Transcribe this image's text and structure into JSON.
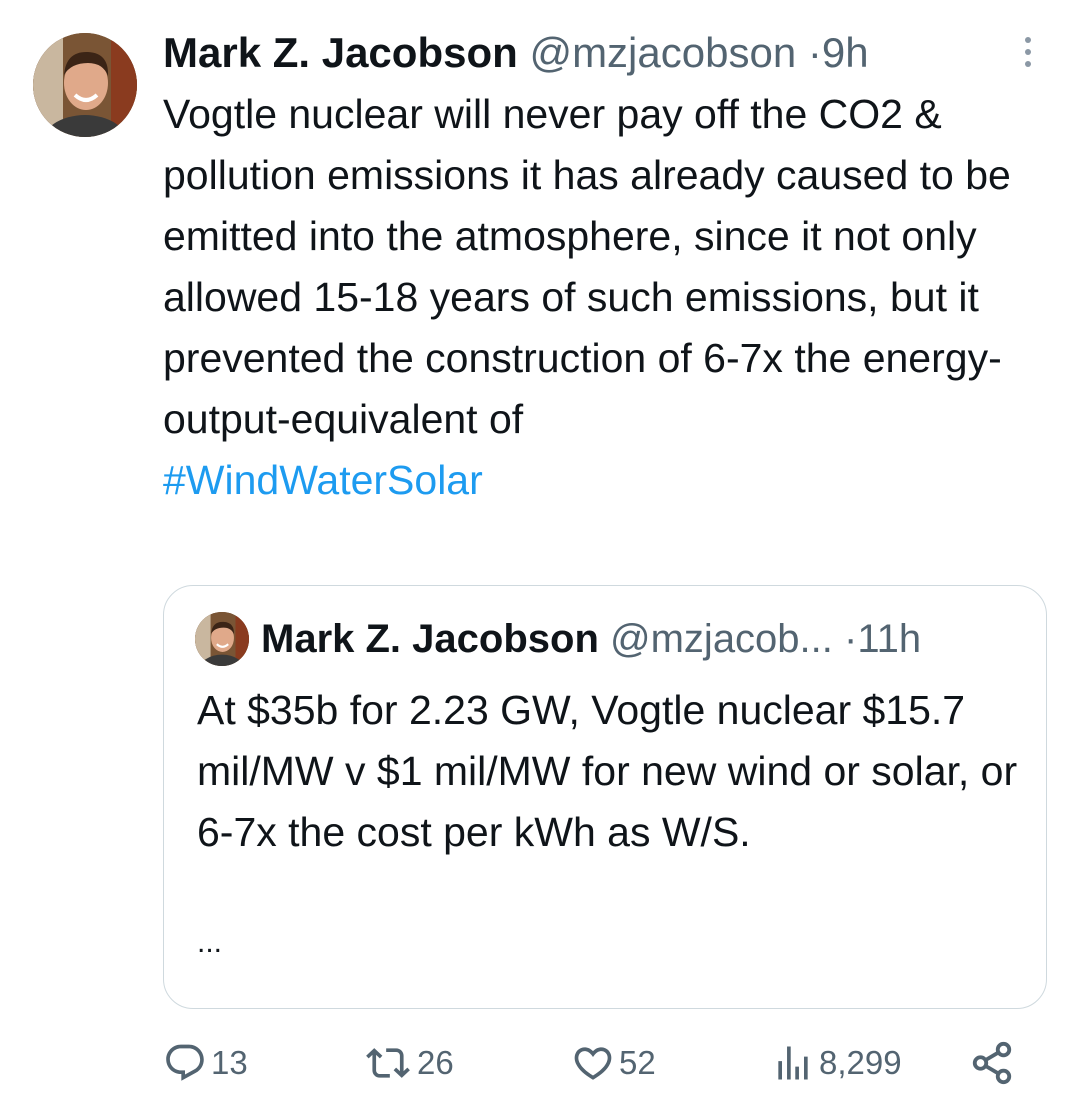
{
  "tweet": {
    "display_name": "Mark Z. Jacobson",
    "handle": "@mzjacobson",
    "separator": "·",
    "time": "9h",
    "body": "Vogtle nuclear will never pay off the CO2 & pollution emissions it has already caused to be emitted into the atmosphere, since it not only allowed 15-18 years of such emissions, but it prevented the construction of 6-7x the energy-output-equivalent of",
    "hashtag": "#WindWaterSolar"
  },
  "quoted": {
    "display_name": "Mark Z. Jacobson",
    "handle": "@mzjacob...",
    "separator": "·",
    "time": "11h",
    "body": "At $35b for 2.23 GW, Vogtle nuclear $15.7 mil/MW v $1 mil/MW for new wind or solar, or 6-7x the cost per kWh as W/S.",
    "ellipsis": "..."
  },
  "actions": {
    "replies": "13",
    "retweets": "26",
    "likes": "52",
    "views": "8,299"
  },
  "icons": {
    "more": "more-vertical-icon",
    "reply": "reply-icon",
    "retweet": "retweet-icon",
    "like": "heart-icon",
    "views": "views-icon",
    "share": "share-icon"
  },
  "colors": {
    "text": "#0f1419",
    "secondary": "#536471",
    "link": "#1d9bf0",
    "border": "#cfd9de"
  }
}
